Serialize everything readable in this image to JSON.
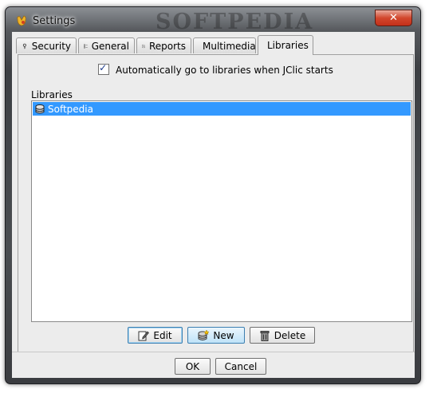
{
  "window": {
    "title": "Settings",
    "watermark": "SOFTPEDIA",
    "close_glyph": "✕"
  },
  "tabs": [
    {
      "label": "Security",
      "icon": "lock-icon"
    },
    {
      "label": "General",
      "icon": "checklist-icon"
    },
    {
      "label": "Reports",
      "icon": "report-icon"
    },
    {
      "label": "Multimedia",
      "icon": "speaker-icon"
    },
    {
      "label": "Libraries",
      "icon": "database-icon",
      "active": true
    }
  ],
  "libraries": {
    "auto_go_label": "Automatically go to libraries when JClic starts",
    "auto_go_checked": true,
    "group_label": "Libraries",
    "items": [
      {
        "label": "Softpedia",
        "selected": true
      }
    ],
    "buttons": {
      "edit": "Edit",
      "new": "New",
      "delete": "Delete"
    }
  },
  "footer": {
    "ok": "OK",
    "cancel": "Cancel"
  },
  "colors": {
    "selection": "#3399ff",
    "panel_bg": "#ececec"
  }
}
